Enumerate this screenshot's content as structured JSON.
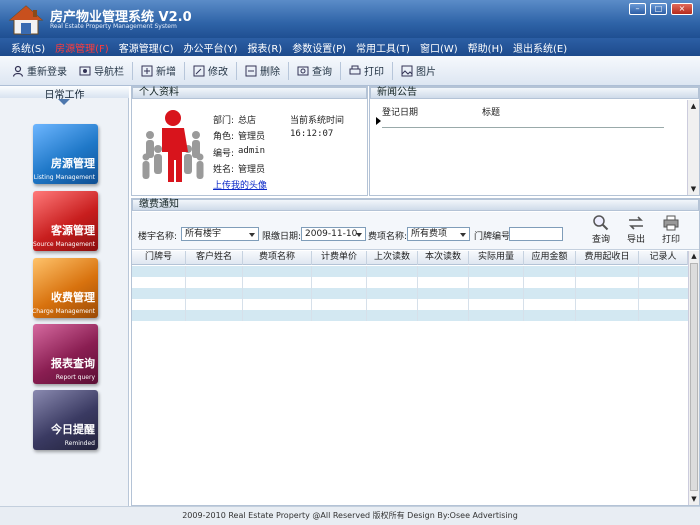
{
  "app": {
    "title": "房产物业管理系统 V2.0",
    "subtitle": "Real Estate Property Management System",
    "window_buttons": {
      "minimize": "–",
      "maximize": "□",
      "close": "×"
    }
  },
  "menu": [
    {
      "label": "系统(S)",
      "active": false
    },
    {
      "label": "房源管理(F)",
      "active": true
    },
    {
      "label": "客源管理(C)",
      "active": false
    },
    {
      "label": "办公平台(Y)",
      "active": false
    },
    {
      "label": "报表(R)",
      "active": false
    },
    {
      "label": "参数设置(P)",
      "active": false
    },
    {
      "label": "常用工具(T)",
      "active": false
    },
    {
      "label": "窗口(W)",
      "active": false
    },
    {
      "label": "帮助(H)",
      "active": false
    },
    {
      "label": "退出系统(E)",
      "active": false
    }
  ],
  "toolbar": {
    "relogin": "重新登录",
    "navbar": "导航栏",
    "add": "新增",
    "edit": "修改",
    "delete": "删除",
    "query": "查询",
    "print": "打印",
    "image": "图片"
  },
  "left": {
    "header": "日常工作",
    "tiles": [
      {
        "title": "房源管理",
        "sub": "Listing Management",
        "color": "#1f78c8"
      },
      {
        "title": "客源管理",
        "sub": "Source Management",
        "color": "#c81e1e"
      },
      {
        "title": "收费管理",
        "sub": "Charge Management",
        "color": "#d8720e"
      },
      {
        "title": "报表查询",
        "sub": "Report query",
        "color": "#8a1e52"
      },
      {
        "title": "今日提醒",
        "sub": "Reminded",
        "color": "#3a3a62"
      }
    ]
  },
  "profile": {
    "header": "个人资料",
    "dept_label": "部门:",
    "dept": "总店",
    "role_label": "角色:",
    "role": "管理员",
    "id_label": "编号:",
    "id": "admin",
    "name_label": "姓名:",
    "name": "管理员",
    "upload_link": "上传我的头像",
    "time_label": "当前系统时间",
    "time": "16:12:07"
  },
  "news": {
    "header": "新闻公告",
    "col_date": "登记日期",
    "col_title": "标题"
  },
  "fees": {
    "header": "缴费通知",
    "building_label": "楼宇名称:",
    "building_value": "所有楼宇",
    "deadline_label": "限缴日期:",
    "deadline_value": "2009-11-10",
    "item_label": "费项名称:",
    "item_value": "所有费项",
    "door_label": "门牌编号",
    "door_value": "",
    "btn_query": "查询",
    "btn_export": "导出",
    "btn_print": "打印",
    "columns": [
      "门牌号",
      "客户姓名",
      "费项名称",
      "计费单价",
      "上次读数",
      "本次读数",
      "实际用量",
      "应用金额",
      "费用起收日",
      "记录人"
    ]
  },
  "footer": "2009-2010 Real Estate Property @All Reserved 版权所有  Design By:Osee Advertising"
}
